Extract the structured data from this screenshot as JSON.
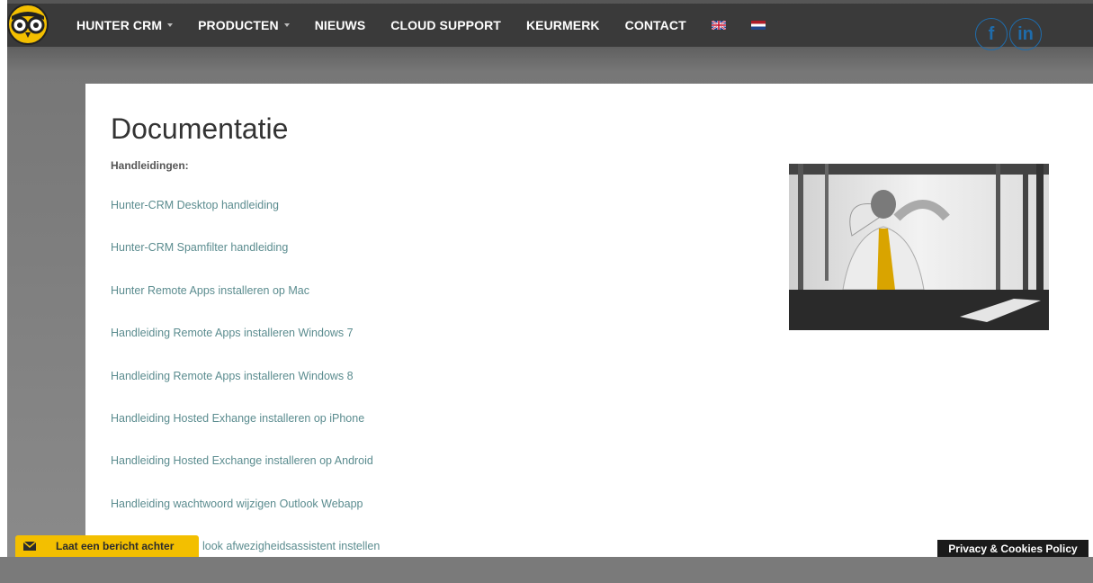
{
  "nav": {
    "items": [
      {
        "label": "HUNTER CRM",
        "dropdown": true
      },
      {
        "label": "PRODUCTEN",
        "dropdown": true
      },
      {
        "label": "NIEUWS",
        "dropdown": false
      },
      {
        "label": "CLOUD SUPPORT",
        "dropdown": false
      },
      {
        "label": "KEURMERK",
        "dropdown": false
      },
      {
        "label": "CONTACT",
        "dropdown": false
      }
    ],
    "flags": [
      "flag-uk-icon",
      "flag-nl-icon"
    ],
    "social": {
      "facebook": "f",
      "linkedin": "in"
    }
  },
  "page": {
    "title": "Documentatie",
    "subheading": "Handleidingen:",
    "links": [
      "Hunter-CRM Desktop handleiding",
      "Hunter-CRM Spamfilter handleiding",
      "Hunter Remote Apps installeren op Mac",
      "Handleiding Remote Apps installeren Windows 7",
      "Handleiding Remote Apps installeren Windows 8",
      "Handleiding Hosted Exhange installeren op iPhone",
      "Handleiding Hosted Exchange installeren op Android",
      "Handleiding wachtwoord wijzigen Outlook Webapp",
      "look afwezigheidsassistent instellen"
    ]
  },
  "widgets": {
    "message_label": "Laat een bericht achter",
    "privacy_label": "Privacy & Cookies Policy"
  },
  "colors": {
    "nav_bg": "#3a3a3a",
    "link": "#5b8c8f",
    "accent": "#f3bf00",
    "social": "#1f6cab"
  }
}
